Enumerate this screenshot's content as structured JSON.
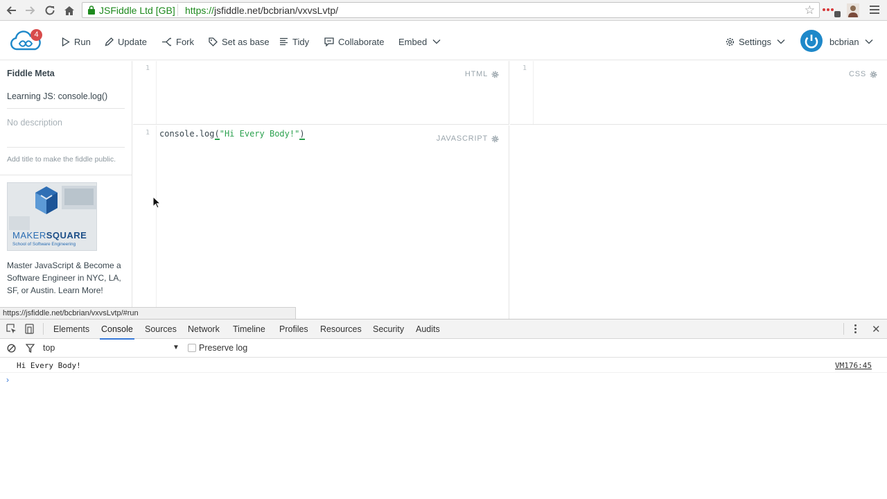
{
  "browser": {
    "ev_name": "JSFiddle Ltd [GB]",
    "url_scheme": "https://",
    "url_rest": "jsfiddle.net/bcbrian/vxvsLvtp/",
    "hover_url": "https://jsfiddle.net/bcbrian/vxvsLvtp/#run"
  },
  "toolbar": {
    "notification_count": "4",
    "run_label": "Run",
    "update_label": "Update",
    "fork_label": "Fork",
    "set_as_base_label": "Set as base",
    "tidy_label": "Tidy",
    "collaborate_label": "Collaborate",
    "embed_label": "Embed",
    "settings_label": "Settings",
    "username": "bcbrian"
  },
  "sidebar": {
    "title": "Fiddle Meta",
    "fiddle_name": "Learning JS: console.log()",
    "description": "No description",
    "hint": "Add title to make the fiddle public.",
    "ad_brand_light": "MAKER",
    "ad_brand_bold": "SQUARE",
    "ad_tagline": "School of Software Engineering",
    "ad_text": "Master JavaScript & Become a Software Engineer in NYC, LA, SF, or Austin. Learn More!"
  },
  "editors": {
    "html": {
      "label": "HTML",
      "line": "1"
    },
    "css": {
      "label": "CSS",
      "line": "1"
    },
    "javascript": {
      "label": "JAVASCRIPT",
      "line": "1",
      "code_obj": "console",
      "code_dot": ".",
      "code_fn": "log",
      "code_open": "(",
      "code_str": "\"Hi Every Body!\"",
      "code_close": ")"
    }
  },
  "devtools": {
    "tabs": [
      "Elements",
      "Console",
      "Sources",
      "Network",
      "Timeline",
      "Profiles",
      "Resources",
      "Security",
      "Audits"
    ],
    "context": "top",
    "preserve_log": "Preserve log",
    "log_message": "Hi Every Body!",
    "log_source": "VM176:45",
    "prompt": "›"
  },
  "colors": {
    "accent_blue": "#3879d9",
    "jsfiddle_blue": "#1e88c9",
    "secure_green": "#1e8a1e",
    "badge_red": "#d84b4b"
  }
}
